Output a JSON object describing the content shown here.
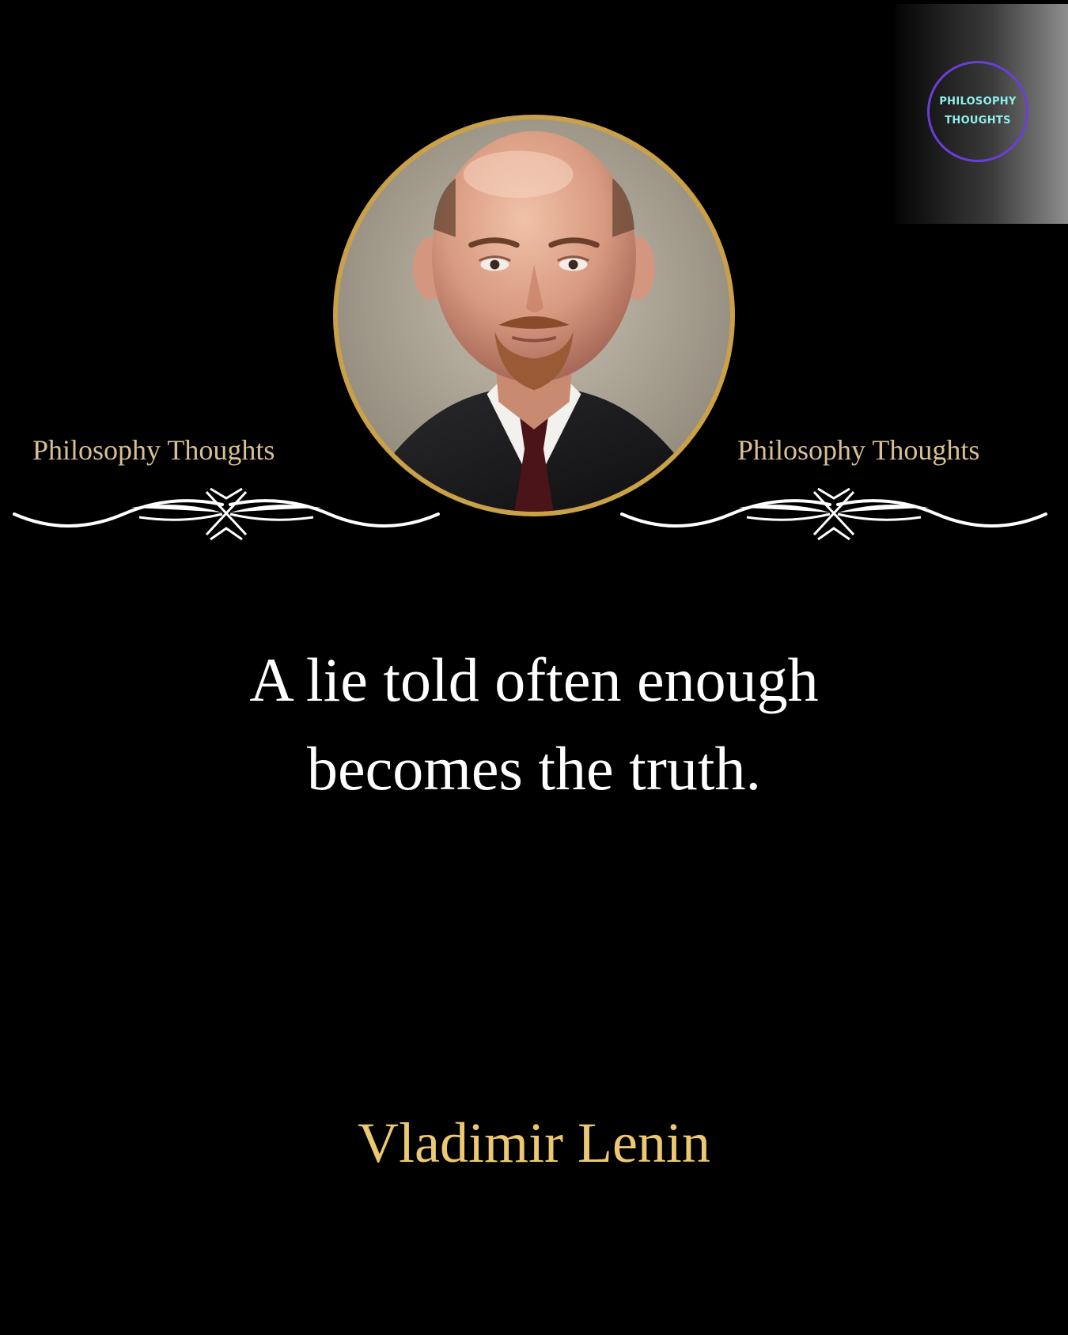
{
  "logo": {
    "line1": "PHILOSOPHY",
    "line2": "THOUGHTS"
  },
  "brand": {
    "left_caption": "Philosophy Thoughts",
    "right_caption": "Philosophy Thoughts"
  },
  "quote": {
    "line1": "A lie told often enough",
    "line2": "becomes the truth."
  },
  "author": "Vladimir Lenin",
  "colors": {
    "background": "#000000",
    "caption": "#d8bf95",
    "quote_text": "#ffffff",
    "author_text": "#ecc872",
    "portrait_frame": "#caa048",
    "logo_ring": "#6a3fd8",
    "logo_text": "#8ef0ec"
  }
}
